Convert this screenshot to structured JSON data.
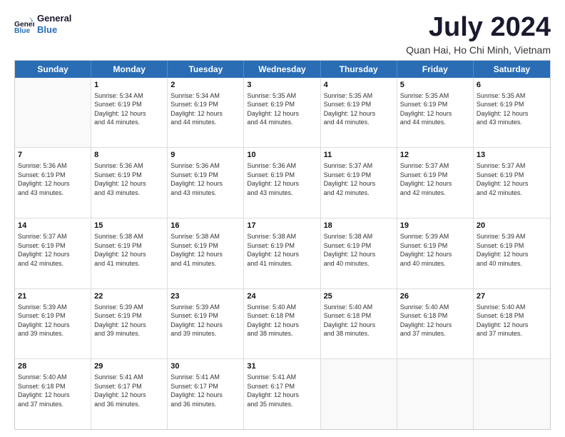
{
  "header": {
    "logo_line1": "General",
    "logo_line2": "Blue",
    "title": "July 2024",
    "subtitle": "Quan Hai, Ho Chi Minh, Vietnam"
  },
  "days": [
    "Sunday",
    "Monday",
    "Tuesday",
    "Wednesday",
    "Thursday",
    "Friday",
    "Saturday"
  ],
  "weeks": [
    [
      {
        "day": "",
        "info": ""
      },
      {
        "day": "1",
        "info": "Sunrise: 5:34 AM\nSunset: 6:19 PM\nDaylight: 12 hours\nand 44 minutes."
      },
      {
        "day": "2",
        "info": "Sunrise: 5:34 AM\nSunset: 6:19 PM\nDaylight: 12 hours\nand 44 minutes."
      },
      {
        "day": "3",
        "info": "Sunrise: 5:35 AM\nSunset: 6:19 PM\nDaylight: 12 hours\nand 44 minutes."
      },
      {
        "day": "4",
        "info": "Sunrise: 5:35 AM\nSunset: 6:19 PM\nDaylight: 12 hours\nand 44 minutes."
      },
      {
        "day": "5",
        "info": "Sunrise: 5:35 AM\nSunset: 6:19 PM\nDaylight: 12 hours\nand 44 minutes."
      },
      {
        "day": "6",
        "info": "Sunrise: 5:35 AM\nSunset: 6:19 PM\nDaylight: 12 hours\nand 43 minutes."
      }
    ],
    [
      {
        "day": "7",
        "info": "Sunrise: 5:36 AM\nSunset: 6:19 PM\nDaylight: 12 hours\nand 43 minutes."
      },
      {
        "day": "8",
        "info": "Sunrise: 5:36 AM\nSunset: 6:19 PM\nDaylight: 12 hours\nand 43 minutes."
      },
      {
        "day": "9",
        "info": "Sunrise: 5:36 AM\nSunset: 6:19 PM\nDaylight: 12 hours\nand 43 minutes."
      },
      {
        "day": "10",
        "info": "Sunrise: 5:36 AM\nSunset: 6:19 PM\nDaylight: 12 hours\nand 43 minutes."
      },
      {
        "day": "11",
        "info": "Sunrise: 5:37 AM\nSunset: 6:19 PM\nDaylight: 12 hours\nand 42 minutes."
      },
      {
        "day": "12",
        "info": "Sunrise: 5:37 AM\nSunset: 6:19 PM\nDaylight: 12 hours\nand 42 minutes."
      },
      {
        "day": "13",
        "info": "Sunrise: 5:37 AM\nSunset: 6:19 PM\nDaylight: 12 hours\nand 42 minutes."
      }
    ],
    [
      {
        "day": "14",
        "info": "Sunrise: 5:37 AM\nSunset: 6:19 PM\nDaylight: 12 hours\nand 42 minutes."
      },
      {
        "day": "15",
        "info": "Sunrise: 5:38 AM\nSunset: 6:19 PM\nDaylight: 12 hours\nand 41 minutes."
      },
      {
        "day": "16",
        "info": "Sunrise: 5:38 AM\nSunset: 6:19 PM\nDaylight: 12 hours\nand 41 minutes."
      },
      {
        "day": "17",
        "info": "Sunrise: 5:38 AM\nSunset: 6:19 PM\nDaylight: 12 hours\nand 41 minutes."
      },
      {
        "day": "18",
        "info": "Sunrise: 5:38 AM\nSunset: 6:19 PM\nDaylight: 12 hours\nand 40 minutes."
      },
      {
        "day": "19",
        "info": "Sunrise: 5:39 AM\nSunset: 6:19 PM\nDaylight: 12 hours\nand 40 minutes."
      },
      {
        "day": "20",
        "info": "Sunrise: 5:39 AM\nSunset: 6:19 PM\nDaylight: 12 hours\nand 40 minutes."
      }
    ],
    [
      {
        "day": "21",
        "info": "Sunrise: 5:39 AM\nSunset: 6:19 PM\nDaylight: 12 hours\nand 39 minutes."
      },
      {
        "day": "22",
        "info": "Sunrise: 5:39 AM\nSunset: 6:19 PM\nDaylight: 12 hours\nand 39 minutes."
      },
      {
        "day": "23",
        "info": "Sunrise: 5:39 AM\nSunset: 6:19 PM\nDaylight: 12 hours\nand 39 minutes."
      },
      {
        "day": "24",
        "info": "Sunrise: 5:40 AM\nSunset: 6:18 PM\nDaylight: 12 hours\nand 38 minutes."
      },
      {
        "day": "25",
        "info": "Sunrise: 5:40 AM\nSunset: 6:18 PM\nDaylight: 12 hours\nand 38 minutes."
      },
      {
        "day": "26",
        "info": "Sunrise: 5:40 AM\nSunset: 6:18 PM\nDaylight: 12 hours\nand 37 minutes."
      },
      {
        "day": "27",
        "info": "Sunrise: 5:40 AM\nSunset: 6:18 PM\nDaylight: 12 hours\nand 37 minutes."
      }
    ],
    [
      {
        "day": "28",
        "info": "Sunrise: 5:40 AM\nSunset: 6:18 PM\nDaylight: 12 hours\nand 37 minutes."
      },
      {
        "day": "29",
        "info": "Sunrise: 5:41 AM\nSunset: 6:17 PM\nDaylight: 12 hours\nand 36 minutes."
      },
      {
        "day": "30",
        "info": "Sunrise: 5:41 AM\nSunset: 6:17 PM\nDaylight: 12 hours\nand 36 minutes."
      },
      {
        "day": "31",
        "info": "Sunrise: 5:41 AM\nSunset: 6:17 PM\nDaylight: 12 hours\nand 35 minutes."
      },
      {
        "day": "",
        "info": ""
      },
      {
        "day": "",
        "info": ""
      },
      {
        "day": "",
        "info": ""
      }
    ]
  ]
}
